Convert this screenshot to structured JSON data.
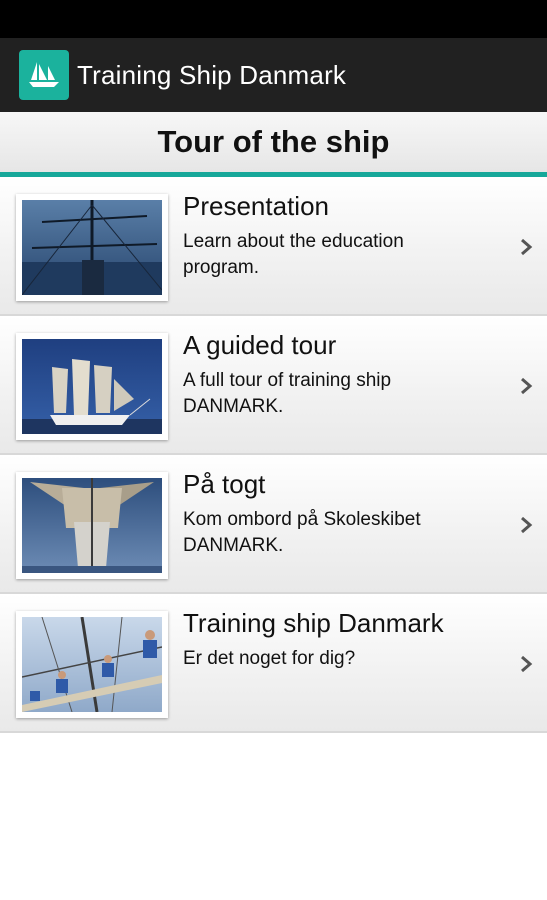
{
  "app": {
    "title": "Training Ship Danmark",
    "icon": "sailing-ship-icon",
    "accent_color": "#17a89a"
  },
  "page": {
    "title": "Tour of the ship"
  },
  "items": [
    {
      "title": "Presentation",
      "description": "Learn about the education program.",
      "image": "ship-rigging-photo"
    },
    {
      "title": "A guided tour",
      "description": "A full tour of training ship DANMARK.",
      "image": "tall-ship-at-sea-photo"
    },
    {
      "title": "På togt",
      "description": "Kom ombord på Skoleskibet DANMARK.",
      "image": "ship-bow-photo"
    },
    {
      "title": "Training ship Danmark",
      "description": "Er det noget for dig?",
      "image": "crew-on-yard-photo"
    }
  ]
}
